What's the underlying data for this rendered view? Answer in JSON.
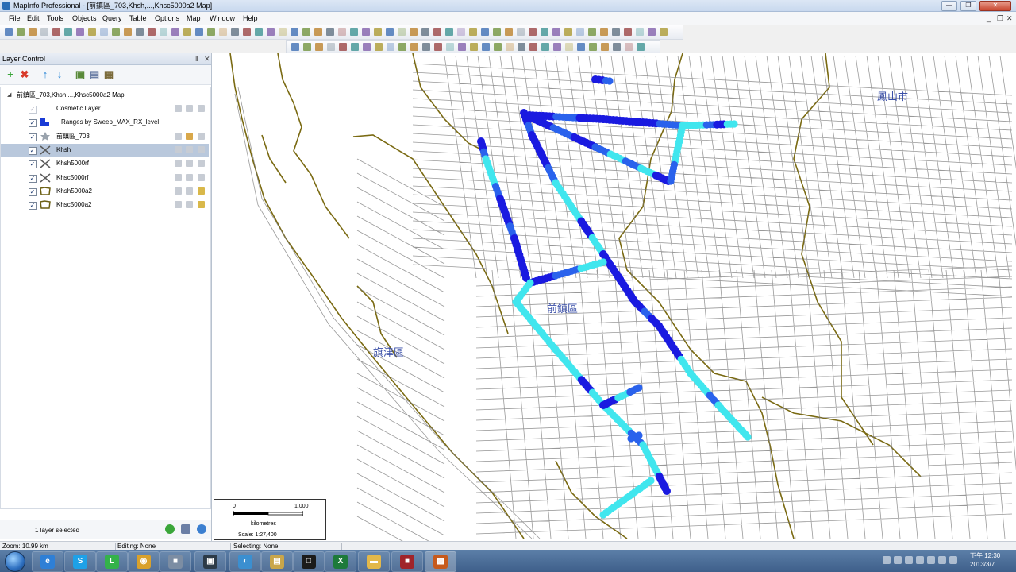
{
  "window": {
    "title": "MapInfo Professional - [前鎮區_703,Khsh,...,Khsc5000a2 Map]",
    "minimize_glyph": "—",
    "restore_glyph": "❐",
    "close_glyph": "✕"
  },
  "menu": {
    "items": [
      "File",
      "Edit",
      "Tools",
      "Objects",
      "Query",
      "Table",
      "Options",
      "Map",
      "Window",
      "Help"
    ],
    "mdi_minimize": "_",
    "mdi_restore": "❐",
    "mdi_close": "✕"
  },
  "layer_control": {
    "title": "Layer Control",
    "pin_glyph": "‖",
    "close_glyph": "✕",
    "tools": [
      {
        "name": "add-layer-icon",
        "glyph": "+",
        "color": "#3aa63a"
      },
      {
        "name": "remove-layer-icon",
        "glyph": "✖",
        "color": "#d83a2a"
      },
      {
        "name": "move-up-icon",
        "glyph": "↑",
        "color": "#2a86d6"
      },
      {
        "name": "move-down-icon",
        "glyph": "↓",
        "color": "#2a86d6"
      },
      {
        "name": "layer-options-icon",
        "glyph": "▣",
        "color": "#5a8a3a"
      },
      {
        "name": "layer-properties-icon",
        "glyph": "▤",
        "color": "#6b7fa6"
      },
      {
        "name": "reorder-layers-icon",
        "glyph": "▦",
        "color": "#7a6a3a"
      }
    ],
    "map_node": "前鎮區_703,Khsh,...,Khsc5000a2 Map",
    "layers": [
      {
        "label": "Cosmetic Layer",
        "checked": true,
        "dim": true,
        "icon": "none"
      },
      {
        "label": "Ranges by Sweep_MAX_RX_level",
        "checked": true,
        "dim": false,
        "icon": "theme"
      },
      {
        "label": "前鎮區_703",
        "checked": true,
        "dim": false,
        "icon": "star"
      },
      {
        "label": "Khsh",
        "checked": true,
        "dim": false,
        "icon": "cross",
        "selected": true
      },
      {
        "label": "Khsh5000rf",
        "checked": true,
        "dim": false,
        "icon": "cross"
      },
      {
        "label": "Khsc5000rf",
        "checked": true,
        "dim": false,
        "icon": "cross"
      },
      {
        "label": "Khsh5000a2",
        "checked": true,
        "dim": false,
        "icon": "region"
      },
      {
        "label": "Khsc5000a2",
        "checked": true,
        "dim": false,
        "icon": "region"
      }
    ],
    "status": "1 layer selected"
  },
  "map": {
    "labels": {
      "qianzhen": "前鎮區",
      "qijin": "旗津區",
      "fengshan": "鳳山市"
    },
    "colors": {
      "road": "#777777",
      "district": "#7a6a12",
      "strong": "#1a1ae0",
      "medium": "#2a62ec",
      "weak": "#40e6ee",
      "weakest": "#38e080"
    },
    "scale": {
      "left_tick": "0",
      "right_tick": "1,000",
      "units": "kilometres",
      "scale_text": "Scale: 1:27,400"
    }
  },
  "statusbar": {
    "zoom": "Zoom: 10.99 km",
    "editing": "Editing: None",
    "selecting": "Selecting: None"
  },
  "taskbar": {
    "time": "下午 12:30",
    "date": "2013/3/7",
    "apps": [
      {
        "name": "ie-icon",
        "glyph": "e",
        "color": "#2e7fd6"
      },
      {
        "name": "skype-icon",
        "glyph": "S",
        "color": "#1ea1e8"
      },
      {
        "name": "line-icon",
        "glyph": "L",
        "color": "#34b24a"
      },
      {
        "name": "chrome-icon",
        "glyph": "◉",
        "color": "#d9a12b"
      },
      {
        "name": "generic-app-icon",
        "glyph": "■",
        "color": "#7c8da3"
      },
      {
        "name": "terminal-icon",
        "glyph": "▣",
        "color": "#2d3b48"
      },
      {
        "name": "remote-icon",
        "glyph": "◐",
        "color": "#3b8fd0"
      },
      {
        "name": "folder-app-icon",
        "glyph": "▤",
        "color": "#c9a64a"
      },
      {
        "name": "notepad-icon",
        "glyph": "□",
        "color": "#1b1b1b"
      },
      {
        "name": "excel-icon",
        "glyph": "X",
        "color": "#1d7a3a"
      },
      {
        "name": "explorer-icon",
        "glyph": "▬",
        "color": "#e3b84a"
      },
      {
        "name": "pdf-icon",
        "glyph": "■",
        "color": "#a0242a"
      },
      {
        "name": "mapinfo-icon",
        "glyph": "▩",
        "color": "#c75a1c",
        "active": true
      }
    ]
  }
}
